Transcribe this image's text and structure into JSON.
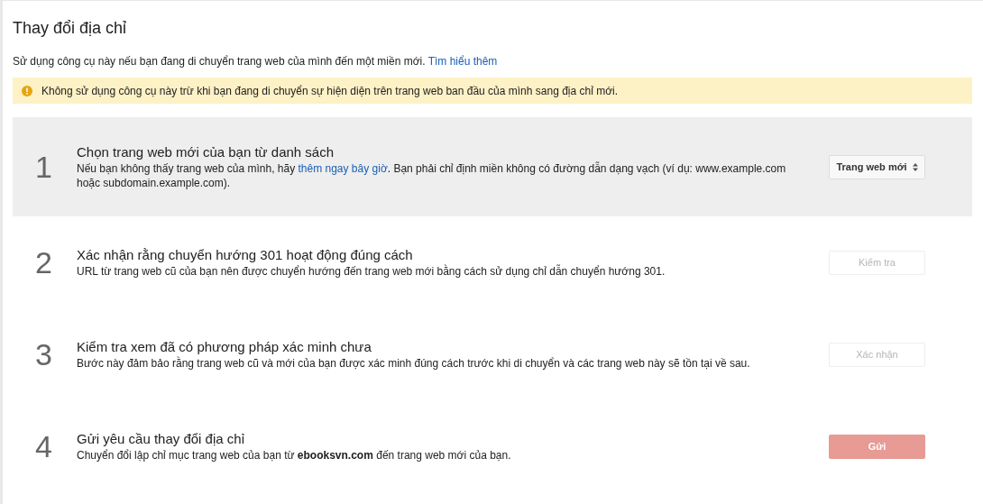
{
  "title": "Thay đổi địa chỉ",
  "intro": {
    "text": "Sử dụng công cụ này nếu bạn đang di chuyển trang web của mình đến một miền mới.",
    "link": "Tìm hiểu thêm"
  },
  "warning": "Không sử dụng công cụ này trừ khi bạn đang di chuyển sự hiện diện trên trang web ban đầu của mình sang địa chỉ mới.",
  "steps": [
    {
      "number": "1",
      "title": "Chọn trang web mới của bạn từ danh sách",
      "active": true,
      "description": [
        "Nếu bạn không thấy trang web của mình, hãy ",
        {
          "link": "thêm ngay bây giờ"
        },
        ". Bạn phải chỉ định miền không có đường dẫn dạng vạch (ví dụ: www.example.com hoặc subdomain.example.com)."
      ],
      "control": {
        "kind": "select",
        "label": "Trang web mới"
      }
    },
    {
      "number": "2",
      "title": "Xác nhận rằng chuyển hướng 301 hoạt động đúng cách",
      "active": false,
      "description": [
        "URL từ trang web cũ của bạn nên được chuyển hướng đến trang web mới bằng cách sử dụng chỉ dẫn chuyển hướng 301."
      ],
      "control": {
        "kind": "button",
        "label": "Kiểm tra",
        "disabled": true
      }
    },
    {
      "number": "3",
      "title": "Kiểm tra xem đã có phương pháp xác minh chưa",
      "active": false,
      "description": [
        "Bước này đảm bảo rằng trang web cũ và mới của bạn được xác minh đúng cách trước khi di chuyển và các trang web này sẽ tồn tại về sau."
      ],
      "control": {
        "kind": "button",
        "label": "Xác nhận",
        "disabled": true
      }
    },
    {
      "number": "4",
      "title": "Gửi yêu cầu thay đổi địa chỉ",
      "active": false,
      "description": [
        "Chuyển đổi lập chỉ mục trang web của bạn từ **ebooksvn.com** đến trang web mới của bạn."
      ],
      "control": {
        "kind": "primary",
        "label": "Gửi",
        "disabled": true
      }
    }
  ]
}
